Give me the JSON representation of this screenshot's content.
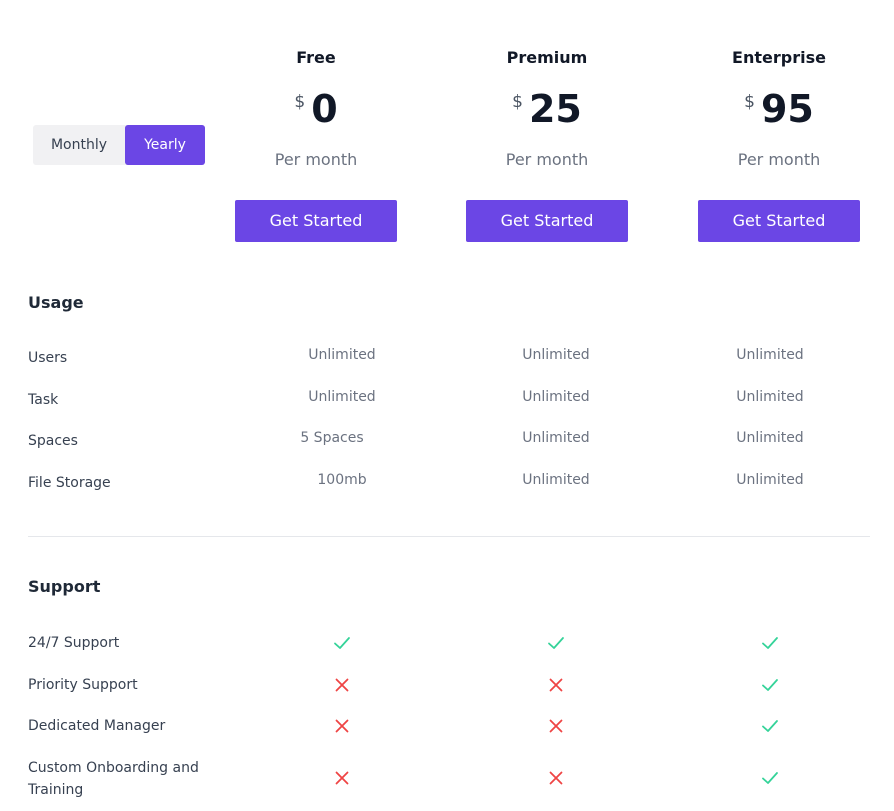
{
  "toggle": {
    "monthly_label": "Monthly",
    "yearly_label": "Yearly",
    "selected": "Yearly"
  },
  "plans": [
    {
      "name": "Free",
      "currency": "$",
      "price": "0",
      "period": "Per month",
      "cta": "Get Started"
    },
    {
      "name": "Premium",
      "currency": "$",
      "price": "25",
      "period": "Per month",
      "cta": "Get Started"
    },
    {
      "name": "Enterprise",
      "currency": "$",
      "price": "95",
      "period": "Per month",
      "cta": "Get Started"
    }
  ],
  "usage": {
    "title": "Usage",
    "rows": [
      {
        "label": "Users",
        "values": [
          "Unlimited",
          "Unlimited",
          "Unlimited"
        ]
      },
      {
        "label": "Task",
        "values": [
          "Unlimited",
          "Unlimited",
          "Unlimited"
        ]
      },
      {
        "label": "Spaces",
        "values": [
          "5 Spaces",
          "Unlimited",
          "Unlimited"
        ]
      },
      {
        "label": "File Storage",
        "values": [
          "100mb",
          "Unlimited",
          "Unlimited"
        ]
      }
    ]
  },
  "support": {
    "title": "Support",
    "rows": [
      {
        "label": "24/7 Support",
        "values": [
          "check-icon",
          "check-icon",
          "check-icon"
        ]
      },
      {
        "label": "Priority Support",
        "values": [
          "cross-icon",
          "cross-icon",
          "check-icon"
        ]
      },
      {
        "label": "Dedicated Manager",
        "values": [
          "cross-icon",
          "cross-icon",
          "check-icon"
        ]
      },
      {
        "label": "Custom Onboarding and Training",
        "values": [
          "cross-icon",
          "cross-icon",
          "check-icon"
        ]
      }
    ]
  },
  "colors": {
    "accent": "#6b46e5",
    "check": "#34d399",
    "cross": "#ef4444"
  }
}
